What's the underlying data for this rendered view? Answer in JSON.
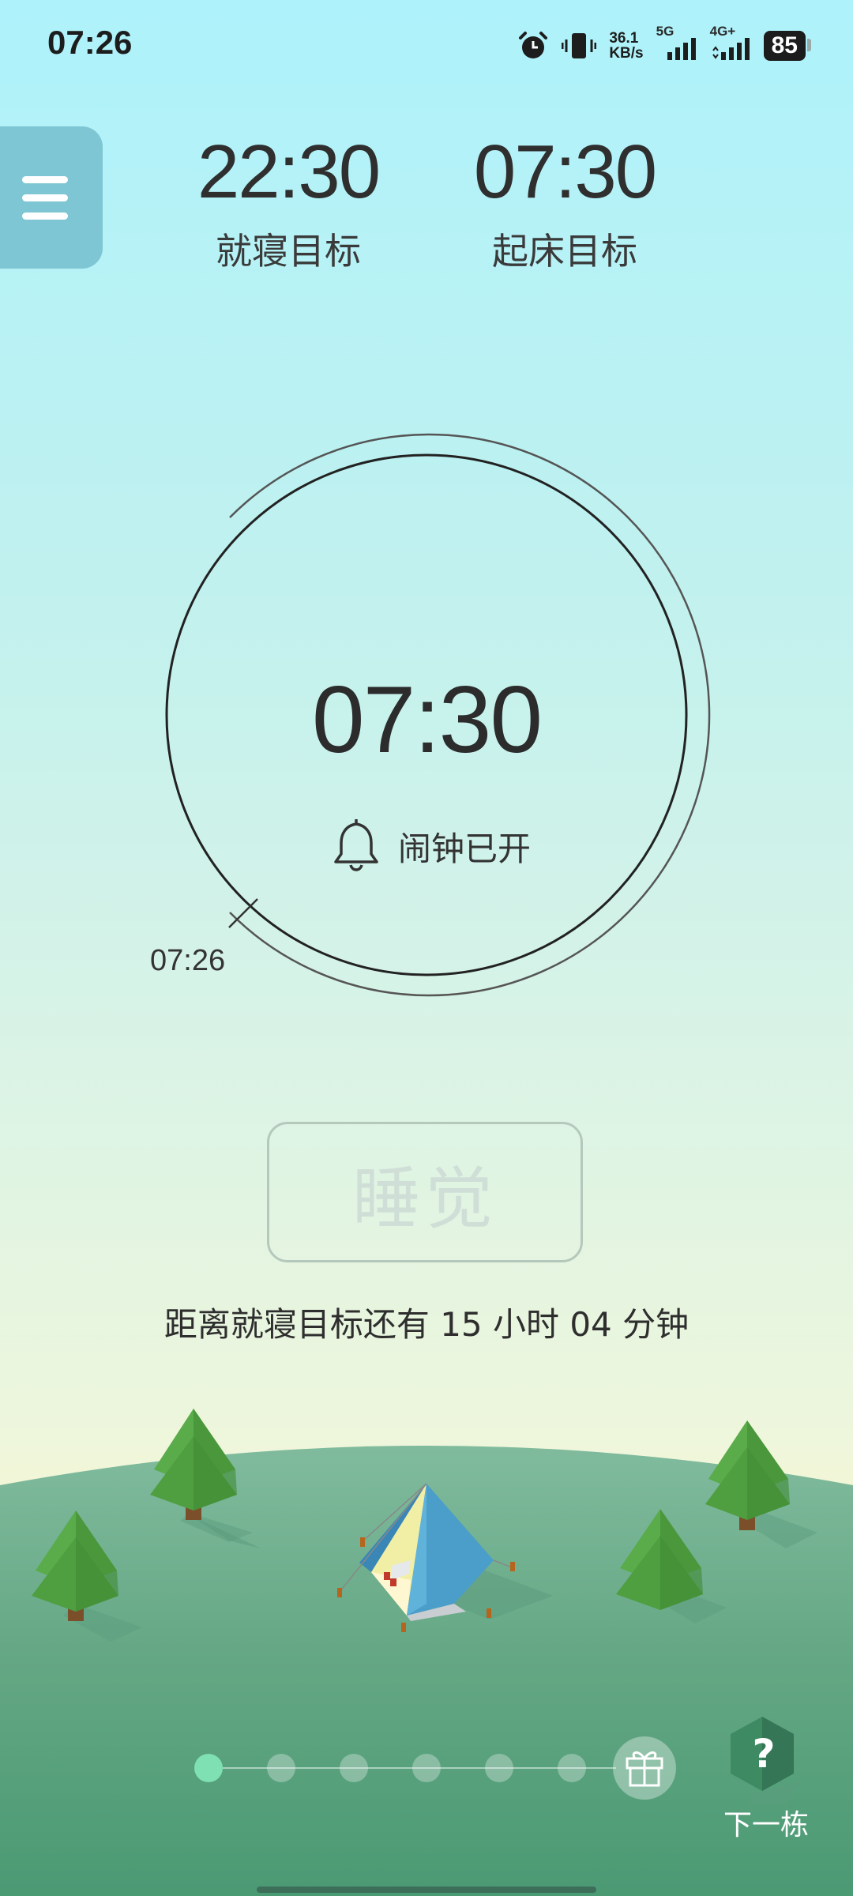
{
  "status_bar": {
    "time": "07:26",
    "net_speed_value": "36.1",
    "net_speed_unit": "KB/s",
    "sig1_label": "5G",
    "sig2_label": "4G+",
    "battery": "85",
    "icons": [
      "alarm-clock-icon",
      "vibrate-icon",
      "signal-5g-icon",
      "signal-4g-icon",
      "battery-icon"
    ]
  },
  "goals": {
    "bedtime_time": "22:30",
    "bedtime_label": "就寝目标",
    "wake_time": "07:30",
    "wake_label": "起床目标"
  },
  "clock": {
    "alarm_time": "07:30",
    "alarm_status": "闹钟已开",
    "current_time": "07:26"
  },
  "sleep_button_label": "睡觉",
  "countdown": "距离就寝目标还有 15 小时 04 分钟",
  "progress": {
    "total_dots": 6,
    "active_dot": 1
  },
  "next_building_label": "下一栋",
  "colors": {
    "menu_bg": "#7ec6d3",
    "hill_green": "#7fb99a",
    "tree_green": "#4e9e43",
    "tent_blue": "#4a9ec9",
    "active_dot": "#7fe0b3"
  }
}
